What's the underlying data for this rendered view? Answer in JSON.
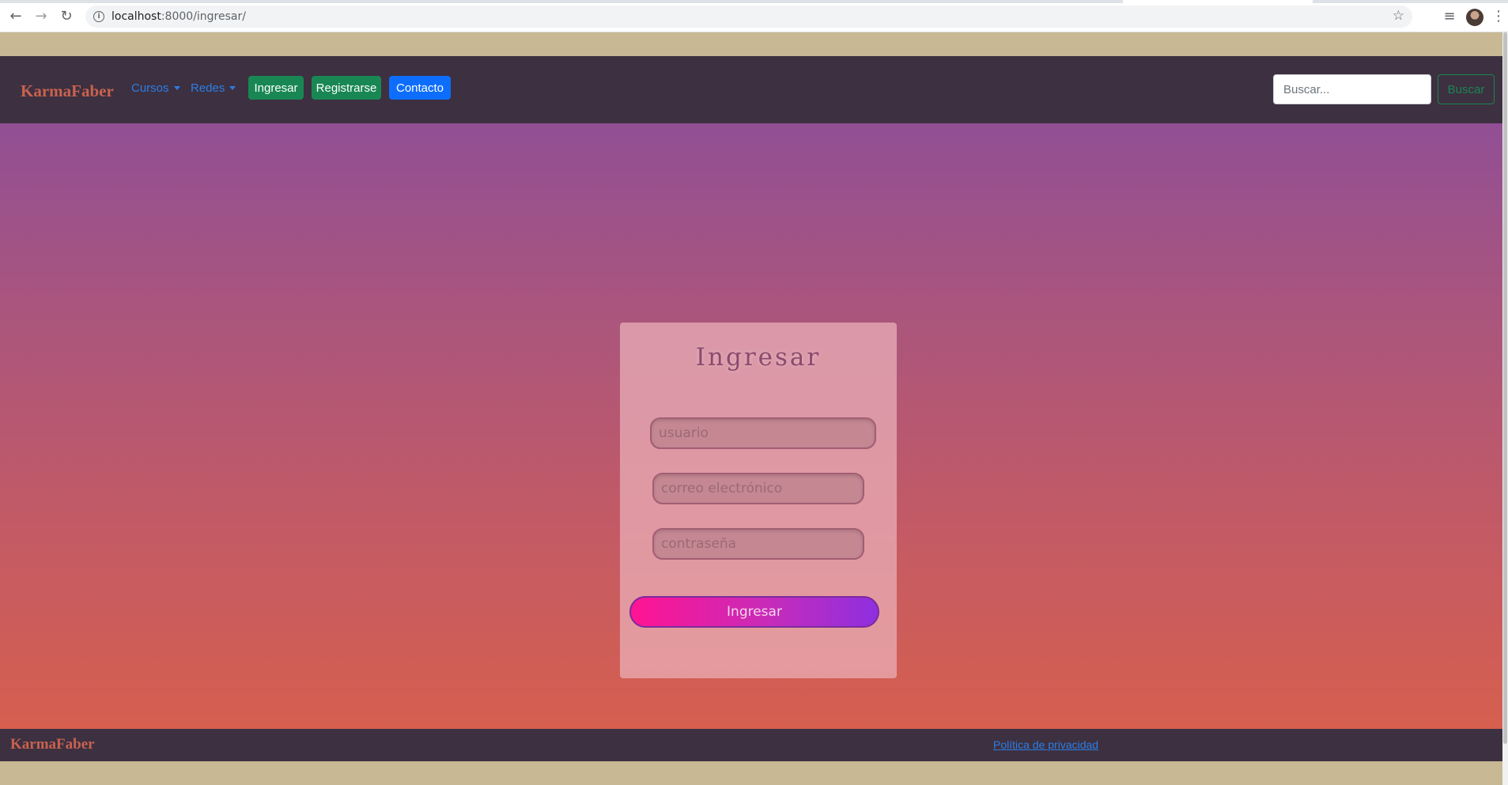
{
  "browser": {
    "url_host": "localhost",
    "url_path": ":8000/ingresar/",
    "back_icon": "←",
    "forward_icon": "→",
    "reload_icon": "↻",
    "info_icon": "i",
    "star_icon": "☆",
    "reading_list_icon": "≡",
    "menu_icon": "⋮"
  },
  "navbar": {
    "brand": "KarmaFaber",
    "links": [
      {
        "label": "Cursos"
      },
      {
        "label": "Redes"
      }
    ],
    "buttons": [
      {
        "label": "Ingresar",
        "color": "#198754"
      },
      {
        "label": "Registrarse",
        "color": "#198754"
      },
      {
        "label": "Contacto",
        "color": "#0d6efd"
      }
    ],
    "search": {
      "placeholder": "Buscar...",
      "button_label": "Buscar"
    }
  },
  "login": {
    "title": "Ingresar",
    "fields": [
      {
        "placeholder": "usuario"
      },
      {
        "placeholder": "correo electrónico"
      },
      {
        "placeholder": "contraseña"
      }
    ],
    "submit_label": "Ingresar"
  },
  "footer": {
    "brand": "KarmaFaber",
    "privacy_link": "Política de privacidad"
  },
  "colors": {
    "navbar_bg": "#3d3040",
    "brand": "#c8624f",
    "page_strip": "#c8b893",
    "gradient_top": "#914f94",
    "gradient_bottom": "#d65f4f"
  }
}
